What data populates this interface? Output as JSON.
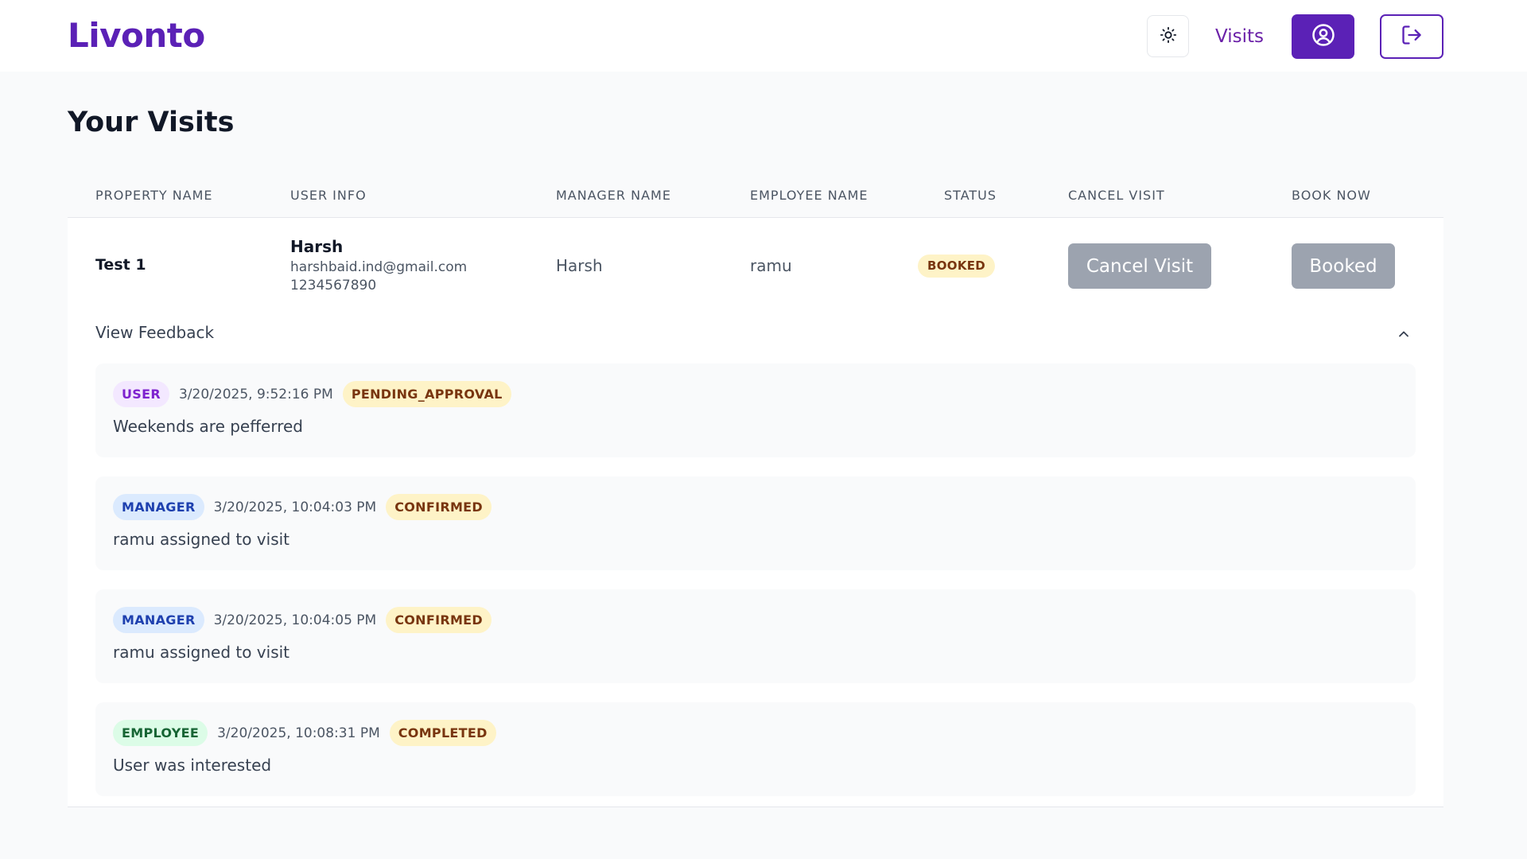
{
  "header": {
    "logo": "Livonto",
    "nav_visits": "Visits",
    "icons": {
      "theme": "sun-icon",
      "profile": "user-circle-icon",
      "logout": "logout-icon"
    },
    "accent": "#5b21b6"
  },
  "page": {
    "title": "Your Visits"
  },
  "table": {
    "columns": [
      "PROPERTY NAME",
      "USER INFO",
      "MANAGER NAME",
      "EMPLOYEE NAME",
      "STATUS",
      "CANCEL VISIT",
      "BOOK NOW"
    ],
    "rows": [
      {
        "property_name": "Test 1",
        "user_name": "Harsh",
        "user_email": "harshbaid.ind@gmail.com",
        "user_phone": "1234567890",
        "manager_name": "Harsh",
        "employee_name": "ramu",
        "status": "BOOKED",
        "cancel_label": "Cancel Visit",
        "book_label": "Booked"
      }
    ]
  },
  "feedback": {
    "toggle_label": "View Feedback",
    "items": [
      {
        "role": "USER",
        "time": "3/20/2025, 9:52:16 PM",
        "status": "PENDING_APPROVAL",
        "message": "Weekends are pefferred"
      },
      {
        "role": "MANAGER",
        "time": "3/20/2025, 10:04:03 PM",
        "status": "CONFIRMED",
        "message": "ramu assigned to visit"
      },
      {
        "role": "MANAGER",
        "time": "3/20/2025, 10:04:05 PM",
        "status": "CONFIRMED",
        "message": "ramu assigned to visit"
      },
      {
        "role": "EMPLOYEE",
        "time": "3/20/2025, 10:08:31 PM",
        "status": "COMPLETED",
        "message": "User was interested"
      }
    ]
  }
}
